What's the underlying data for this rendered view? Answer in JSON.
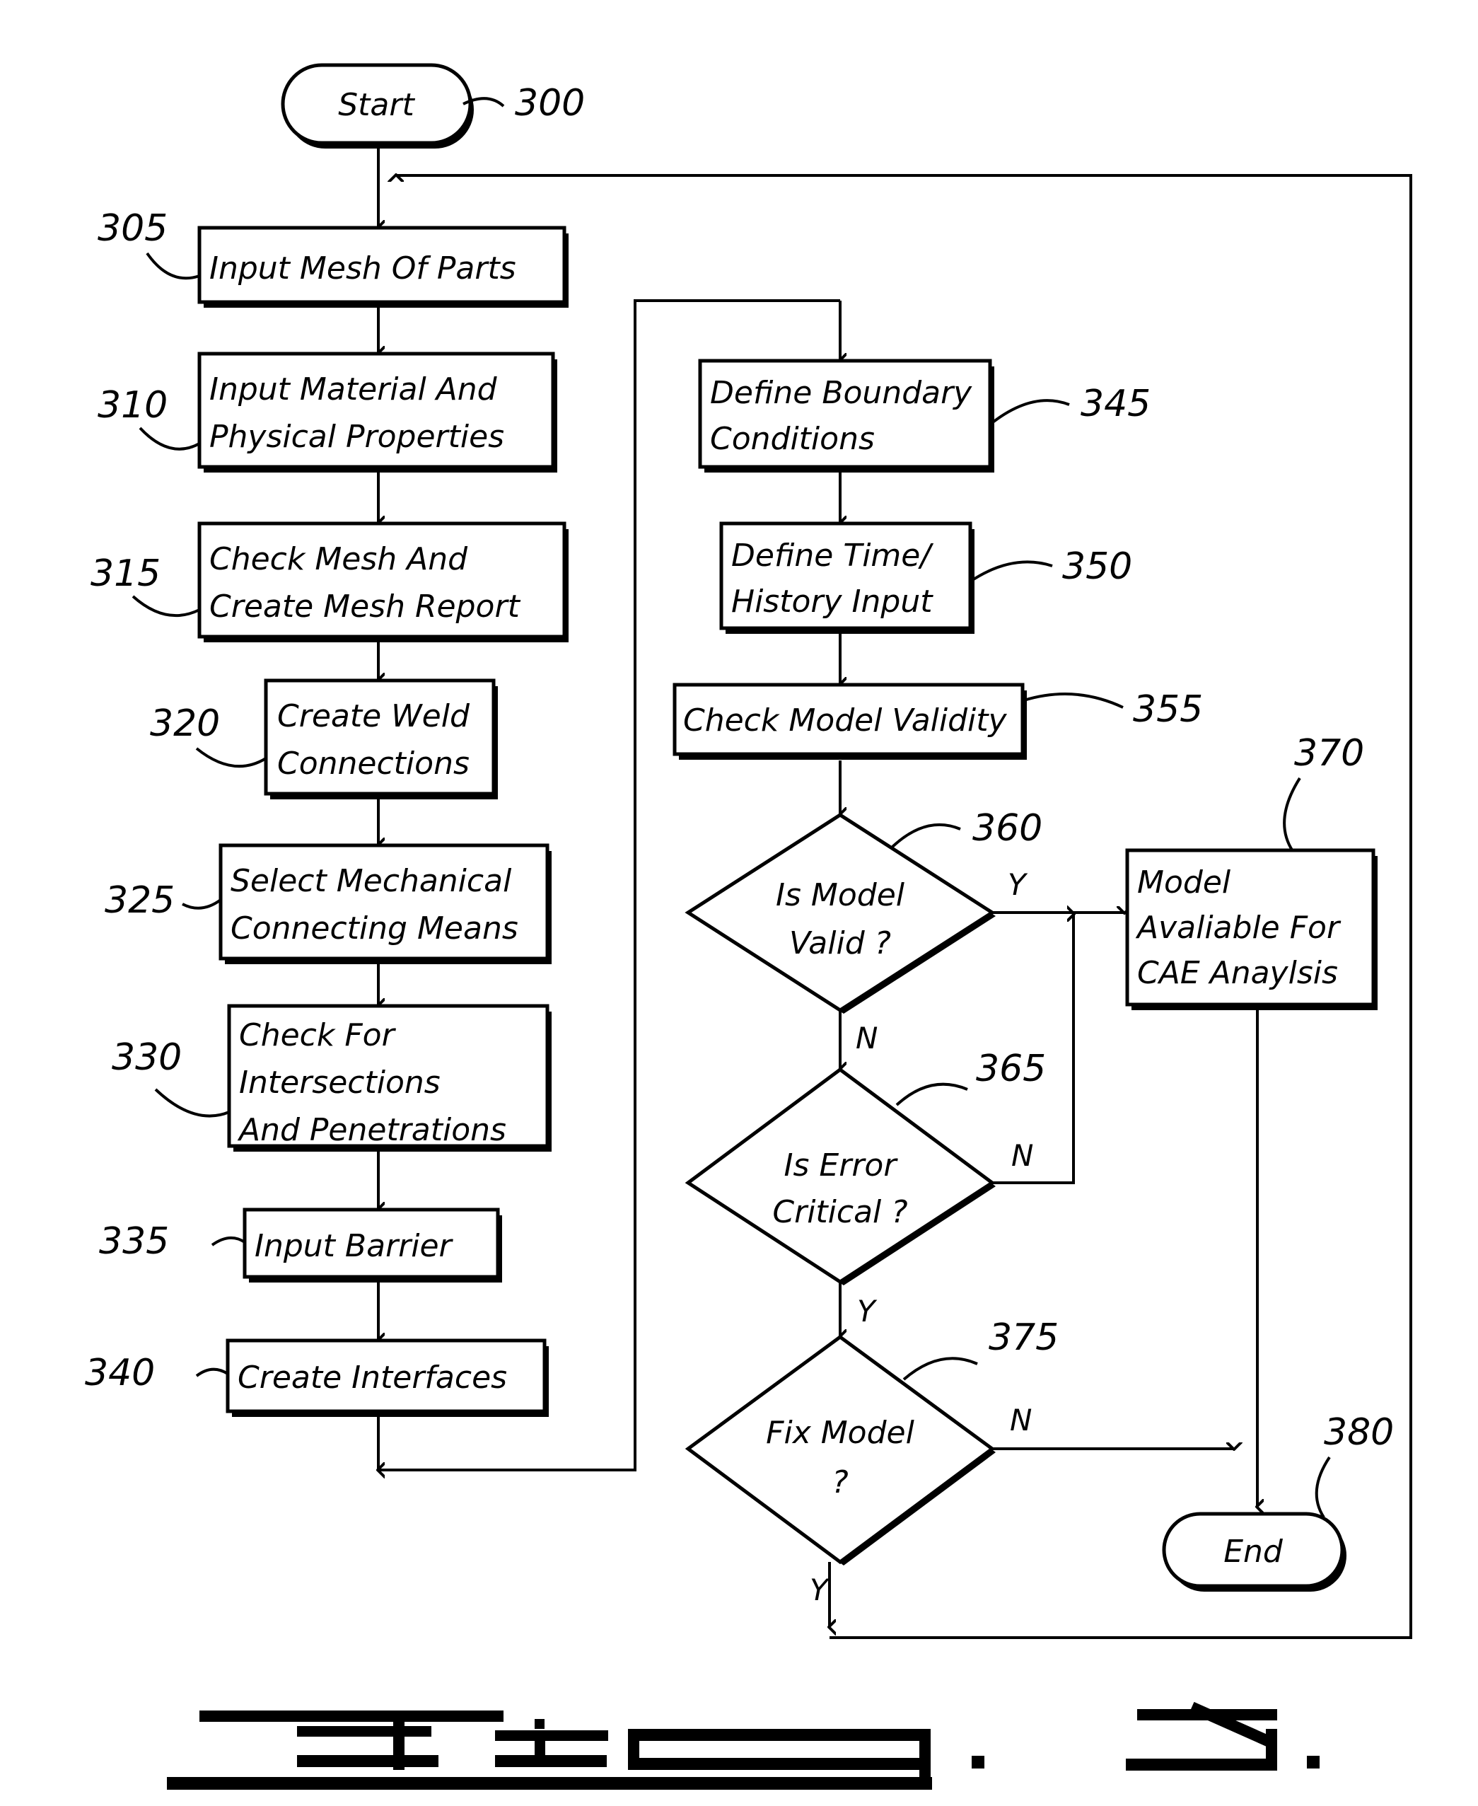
{
  "figure": {
    "caption": "FIG. 3.",
    "caption_number": "3"
  },
  "nodes": {
    "start": {
      "ref": "300",
      "label": "Start",
      "type": "terminator"
    },
    "input_mesh": {
      "ref": "305",
      "lines": [
        "Input Mesh Of Parts"
      ],
      "type": "process"
    },
    "input_mat": {
      "ref": "310",
      "lines": [
        "Input Material And",
        "Physical Properties"
      ],
      "type": "process"
    },
    "check_mesh": {
      "ref": "315",
      "lines": [
        "Check Mesh And",
        "Create Mesh Report"
      ],
      "type": "process"
    },
    "create_weld": {
      "ref": "320",
      "lines": [
        "Create Weld",
        "Connections"
      ],
      "type": "process"
    },
    "select_mech": {
      "ref": "325",
      "lines": [
        "Select Mechanical",
        "Connecting Means"
      ],
      "type": "process"
    },
    "check_inter": {
      "ref": "330",
      "lines": [
        "Check For",
        "Intersections",
        "And Penetrations"
      ],
      "type": "process"
    },
    "input_barrier": {
      "ref": "335",
      "lines": [
        "Input Barrier"
      ],
      "type": "process"
    },
    "create_iface": {
      "ref": "340",
      "lines": [
        "Create Interfaces"
      ],
      "type": "process"
    },
    "def_bc": {
      "ref": "345",
      "lines": [
        "Define Boundary",
        "Conditions"
      ],
      "type": "process"
    },
    "def_time": {
      "ref": "350",
      "lines": [
        "Define Time/",
        "History Input"
      ],
      "type": "process"
    },
    "check_valid": {
      "ref": "355",
      "lines": [
        "Check Model Validity"
      ],
      "type": "process"
    },
    "is_valid": {
      "ref": "360",
      "lines": [
        "Is Model",
        "Valid ?"
      ],
      "type": "decision"
    },
    "is_error": {
      "ref": "365",
      "lines": [
        "Is Error",
        "Critical ?"
      ],
      "type": "decision"
    },
    "model_avail": {
      "ref": "370",
      "lines": [
        "Model",
        "Avaliable For",
        "CAE Anaylsis"
      ],
      "type": "process"
    },
    "fix_model": {
      "ref": "375",
      "lines": [
        "Fix Model",
        "?"
      ],
      "type": "decision"
    },
    "end": {
      "ref": "380",
      "label": "End",
      "type": "terminator"
    }
  },
  "branch_labels": {
    "is_valid_yes": "Y",
    "is_valid_no": "N",
    "is_error_no": "N",
    "is_error_yes": "Y",
    "fix_model_no": "N",
    "fix_model_yes": "Y"
  },
  "colors": {
    "ink": "#000000",
    "paper": "#ffffff"
  }
}
